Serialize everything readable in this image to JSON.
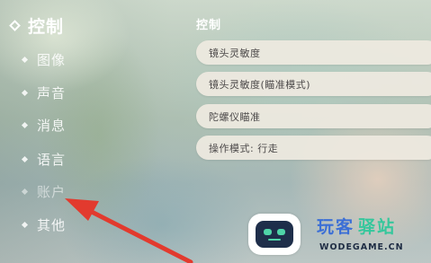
{
  "menu": {
    "items": [
      {
        "label": "控制"
      },
      {
        "label": "图像"
      },
      {
        "label": "声音"
      },
      {
        "label": "消息"
      },
      {
        "label": "语言"
      },
      {
        "label": "账户"
      },
      {
        "label": "其他"
      }
    ]
  },
  "panel": {
    "title": "控制",
    "settings": [
      {
        "label": "镜头灵敏度"
      },
      {
        "label": "镜头灵敏度(瞄准模式)"
      },
      {
        "label": "陀螺仪瞄准"
      },
      {
        "label": "操作模式: 行走"
      }
    ]
  },
  "watermark": {
    "cn_part1": "玩客",
    "cn_part2": "驿站",
    "domain": "WODEGAME.CN"
  },
  "colors": {
    "arrow": "#e23a2e",
    "row_bg": "#eee9e0",
    "watermark_blue": "#3b6fd6",
    "watermark_green": "#35c79c"
  },
  "icons": {
    "active_marker": "diamond-outline-icon",
    "item_marker": "diamond-bullet-icon",
    "annotation": "red-arrow-icon",
    "logo": "robot-logo-icon"
  }
}
